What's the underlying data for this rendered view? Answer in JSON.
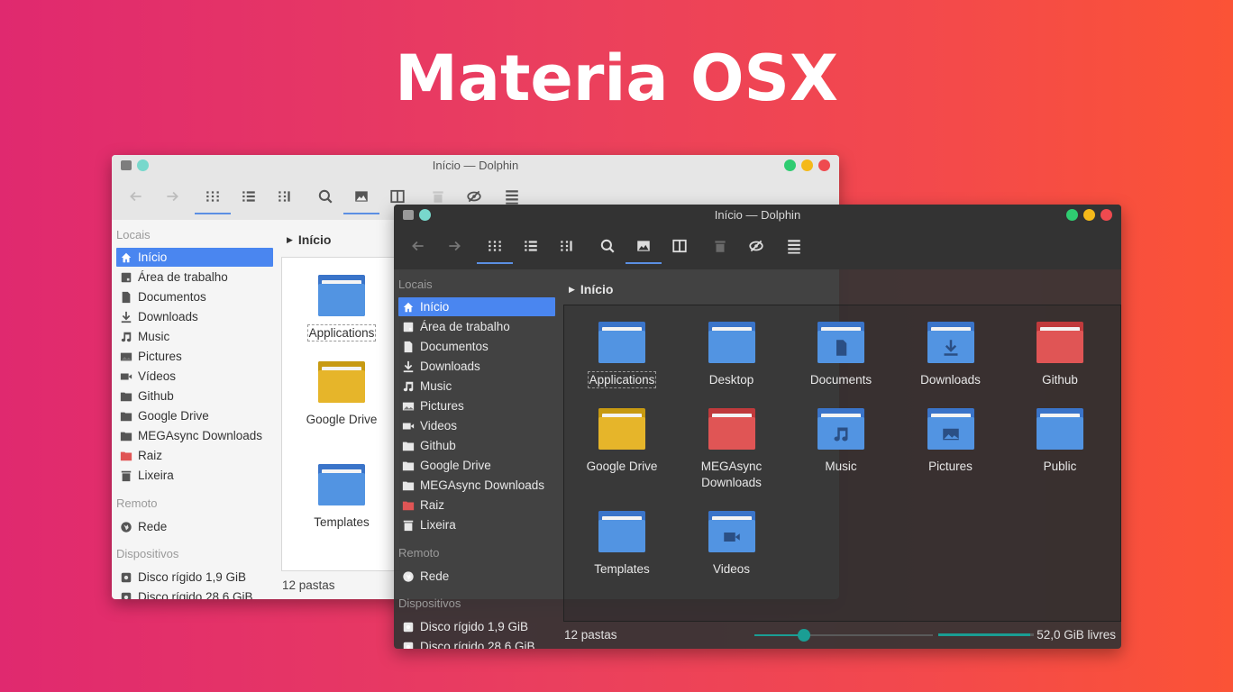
{
  "hero": {
    "title": "Materia OSX"
  },
  "light_window": {
    "title": "Início — Dolphin",
    "sidebar": {
      "locais_header": "Locais",
      "items": [
        {
          "label": "Início",
          "icon": "home-icon"
        },
        {
          "label": "Área de trabalho",
          "icon": "desktop-icon"
        },
        {
          "label": "Documentos",
          "icon": "document-icon"
        },
        {
          "label": "Downloads",
          "icon": "download-icon"
        },
        {
          "label": "Music",
          "icon": "music-icon"
        },
        {
          "label": "Pictures",
          "icon": "picture-icon"
        },
        {
          "label": "Vídeos",
          "icon": "video-icon"
        },
        {
          "label": "Github",
          "icon": "folder-icon"
        },
        {
          "label": "Google Drive",
          "icon": "folder-icon"
        },
        {
          "label": "MEGAsync Downloads",
          "icon": "folder-icon"
        },
        {
          "label": "Raiz",
          "icon": "red-folder-icon"
        },
        {
          "label": "Lixeira",
          "icon": "trash-icon"
        }
      ],
      "remoto_header": "Remoto",
      "rede": "Rede",
      "dispositivos_header": "Dispositivos",
      "disk1": "Disco rígido 1,9 GiB",
      "disk2": "Disco rígido 28,6 GiB"
    },
    "breadcrumb": "Início",
    "files": [
      "Applications",
      "Google Drive",
      "Templates"
    ],
    "status_count": "12 pastas"
  },
  "dark_window": {
    "title": "Início — Dolphin",
    "sidebar": {
      "locais_header": "Locais",
      "items": [
        {
          "label": "Início",
          "icon": "home-icon"
        },
        {
          "label": "Área de trabalho",
          "icon": "desktop-icon"
        },
        {
          "label": "Documentos",
          "icon": "document-icon"
        },
        {
          "label": "Downloads",
          "icon": "download-icon"
        },
        {
          "label": "Music",
          "icon": "music-icon"
        },
        {
          "label": "Pictures",
          "icon": "picture-icon"
        },
        {
          "label": "Videos",
          "icon": "video-icon"
        },
        {
          "label": "Github",
          "icon": "folder-icon"
        },
        {
          "label": "Google Drive",
          "icon": "folder-icon"
        },
        {
          "label": "MEGAsync Downloads",
          "icon": "folder-icon"
        },
        {
          "label": "Raiz",
          "icon": "red-folder-icon"
        },
        {
          "label": "Lixeira",
          "icon": "trash-icon"
        }
      ],
      "remoto_header": "Remoto",
      "rede": "Rede",
      "dispositivos_header": "Dispositivos",
      "disk1": "Disco rígido 1,9 GiB",
      "disk2": "Disco rígido 28,6 GiB"
    },
    "breadcrumb": "Início",
    "files": [
      {
        "label": "Applications",
        "color": "blue",
        "glyph": ""
      },
      {
        "label": "Desktop",
        "color": "blue",
        "glyph": ""
      },
      {
        "label": "Documents",
        "color": "blue",
        "glyph": "document"
      },
      {
        "label": "Downloads",
        "color": "blue",
        "glyph": "download"
      },
      {
        "label": "Github",
        "color": "red",
        "glyph": ""
      },
      {
        "label": "Google Drive",
        "color": "yellow",
        "glyph": ""
      },
      {
        "label": "MEGAsync Downloads",
        "color": "red",
        "glyph": ""
      },
      {
        "label": "Music",
        "color": "blue",
        "glyph": "music"
      },
      {
        "label": "Pictures",
        "color": "blue",
        "glyph": "picture"
      },
      {
        "label": "Public",
        "color": "blue",
        "glyph": ""
      },
      {
        "label": "Templates",
        "color": "blue",
        "glyph": ""
      },
      {
        "label": "Videos",
        "color": "blue",
        "glyph": "video"
      }
    ],
    "status_count": "12 pastas",
    "free_space": "52,0 GiB livres",
    "zoom_level": 0.28,
    "space_used_fraction": 0.96
  },
  "colors": {
    "accent": "#4a86f0",
    "folder_blue": "#5294e2",
    "folder_yellow": "#e6b52a",
    "folder_red": "#e05555",
    "slider_teal": "#1a9e94"
  }
}
